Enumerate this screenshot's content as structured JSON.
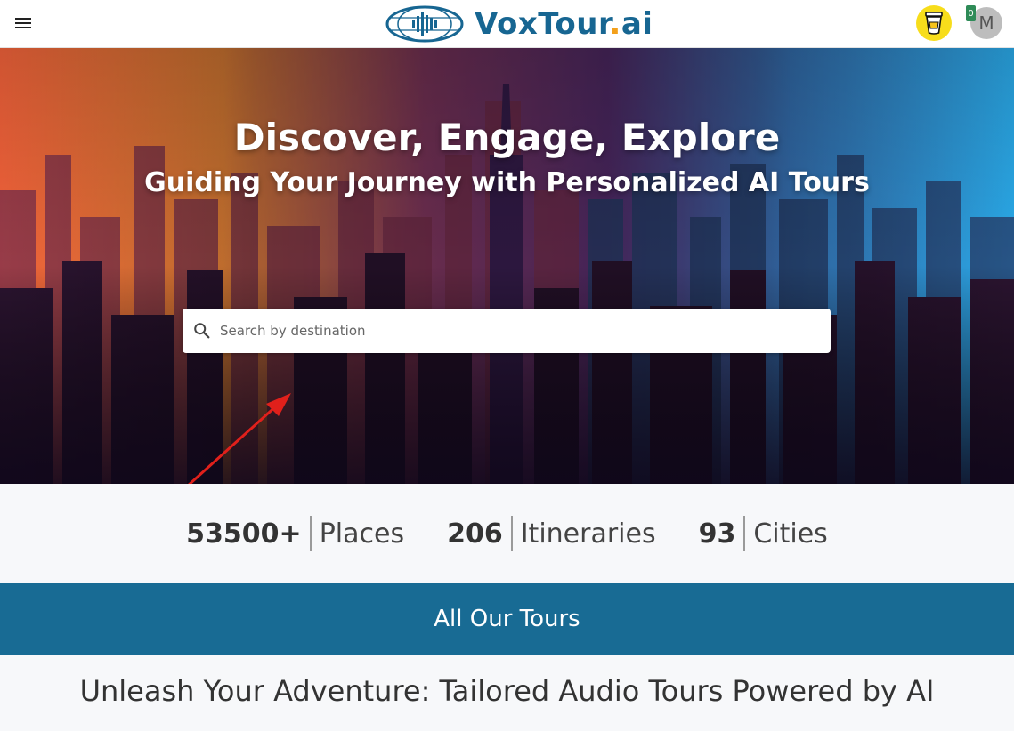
{
  "header": {
    "menu_icon": "hamburger-menu-icon",
    "logo": {
      "text_main": "VoxTour",
      "text_dot": ".",
      "text_suffix": "ai"
    },
    "coffee_icon": "buy-me-a-coffee-icon",
    "badge_count": "0",
    "avatar_letter": "M"
  },
  "hero": {
    "title": "Discover, Engage, Explore",
    "subtitle": "Guiding Your Journey with Personalized AI Tours",
    "search": {
      "placeholder": "Search by destination",
      "value": "",
      "icon": "search-icon"
    }
  },
  "stats": [
    {
      "number": "53500+",
      "label": "Places"
    },
    {
      "number": "206",
      "label": "Itineraries"
    },
    {
      "number": "93",
      "label": "Cities"
    }
  ],
  "tours_band": {
    "label": "All Our Tours"
  },
  "tagline": "Unleash Your Adventure: Tailored Audio Tours Powered by AI",
  "colors": {
    "brand": "#176692",
    "accent": "#f3a01b",
    "band": "#186b94",
    "annotation_arrow": "#e0201b"
  }
}
